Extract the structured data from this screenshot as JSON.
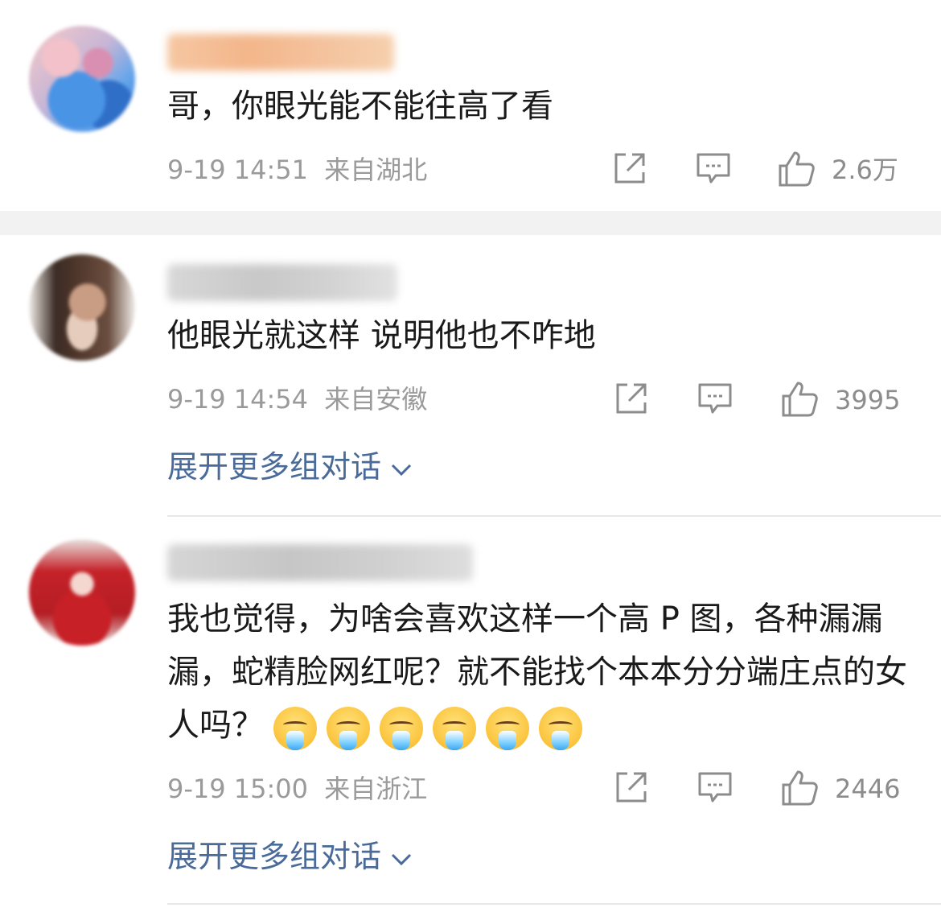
{
  "comments": [
    {
      "text": "哥，你眼光能不能往高了看",
      "date": "9-19 14:51",
      "location": "来自湖北",
      "likes": "2.6万",
      "expand": ""
    },
    {
      "text": "他眼光就这样 说明他也不咋地",
      "date": "9-19 14:54",
      "location": "来自安徽",
      "likes": "3995",
      "expand": "展开更多组对话"
    },
    {
      "text": "我也觉得，为啥会喜欢这样一个高 P 图，各种漏漏漏，蛇精脸网红呢？就不能找个本本分分端庄点的女人吗？",
      "date": "9-19 15:00",
      "location": "来自浙江",
      "likes": "2446",
      "expand": "展开更多组对话"
    }
  ],
  "icons": {
    "repost": "share-square-icon",
    "reply": "comment-bubble-icon",
    "like": "thumbs-up-icon",
    "expand": "chevron-down-icon",
    "emoji": "vomit-face-emoji"
  },
  "colors": {
    "link": "#4a6b9a",
    "meta": "#9a9a9a",
    "divider": "#f2f2f2"
  }
}
